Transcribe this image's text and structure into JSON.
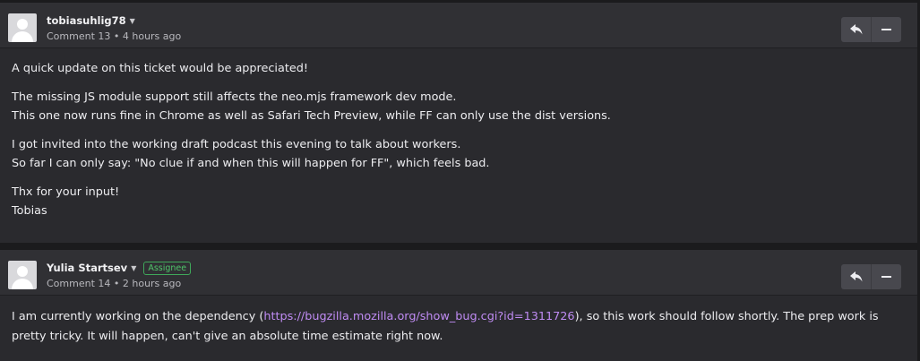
{
  "comments": [
    {
      "author": "tobiasuhlig78",
      "badge": "",
      "meta": "Comment 13 • 4 hours ago",
      "paragraphs": [
        [
          "A quick update on this ticket would be appreciated!"
        ],
        [
          "The missing JS module support still affects the neo.mjs framework dev mode.",
          "This one now runs fine in Chrome as well as Safari Tech Preview, while FF can only use the dist versions."
        ],
        [
          "I got invited into the working draft podcast this evening to talk about workers.",
          "So far I can only say: \"No clue if and when this will happen for FF\", which feels bad."
        ],
        [
          "Thx for your input!",
          "Tobias"
        ]
      ]
    },
    {
      "author": "Yulia Startsev",
      "badge": "Assignee",
      "meta": "Comment 14 • 2 hours ago",
      "body_before": "I am currently working on the dependency (",
      "body_link": "https://bugzilla.mozilla.org/show_bug.cgi?id=1311726",
      "body_after": "), so this work should follow shortly. The prep work is pretty tricky. It will happen, can't give an absolute time estimate right now."
    }
  ],
  "icons": {
    "author_menu": "caret-down-icon",
    "reply": "reply-icon",
    "collapse": "minus-icon",
    "avatar": "default-avatar-icon"
  },
  "colors": {
    "background": "#1b1b1d",
    "comment_bg": "#2a2a2e",
    "header_bg": "#303034",
    "button_bg": "#48484e",
    "link": "#c08cf4",
    "assignee_badge": "#4fc56a"
  }
}
